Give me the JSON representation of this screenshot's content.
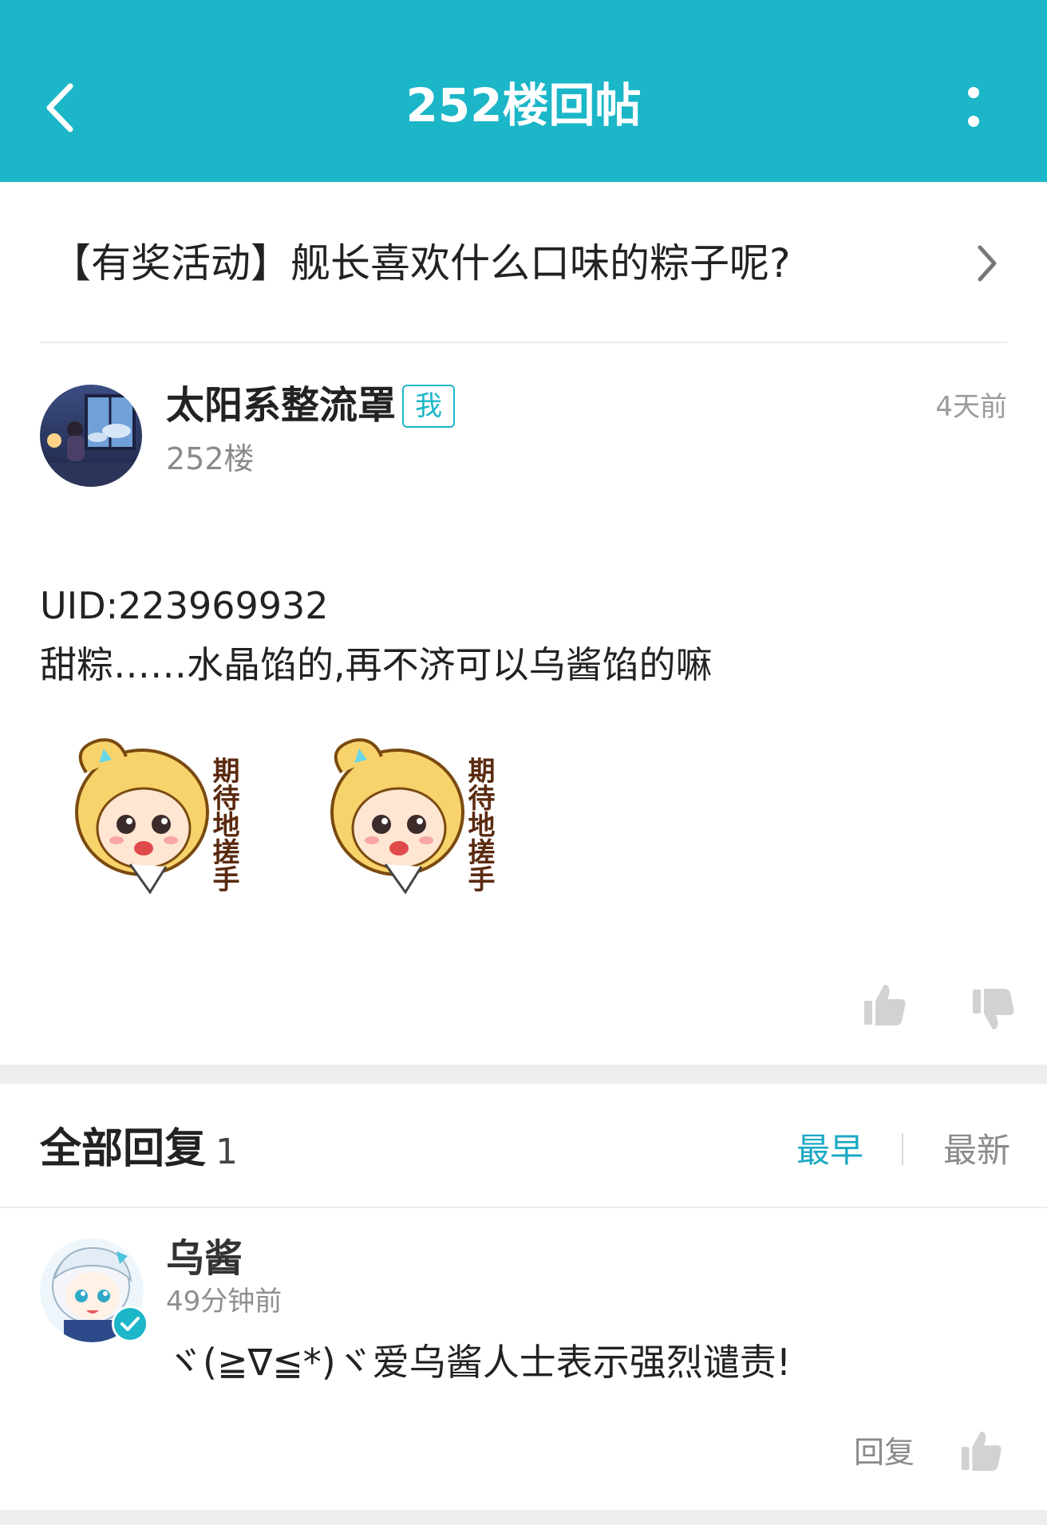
{
  "header": {
    "title": "252楼回帖",
    "bg_color": "#1bb6c8",
    "back_icon": "chevron-left-icon",
    "more_icon": "more-vertical-icon"
  },
  "thread": {
    "title": "【有奖活动】舰长喜欢什么口味的粽子呢?"
  },
  "post": {
    "author": "太阳系整流罩",
    "me_badge": "我",
    "floor": "252楼",
    "time": "4天前",
    "line1": "UID:223969932",
    "line2": "甜粽……水晶馅的,再不济可以乌酱馅的嘛",
    "sticker_text": "期待地搓手"
  },
  "replies": {
    "title": "全部回复",
    "count": "1",
    "sort_earliest": "最早",
    "sort_latest": "最新",
    "accent_color": "#1aa9c4",
    "items": [
      {
        "author": "乌酱",
        "time": "49分钟前",
        "text": "ヾ(≧∇≦*)ヾ爱乌酱人士表示强烈谴责!",
        "reply_label": "回复"
      }
    ]
  }
}
